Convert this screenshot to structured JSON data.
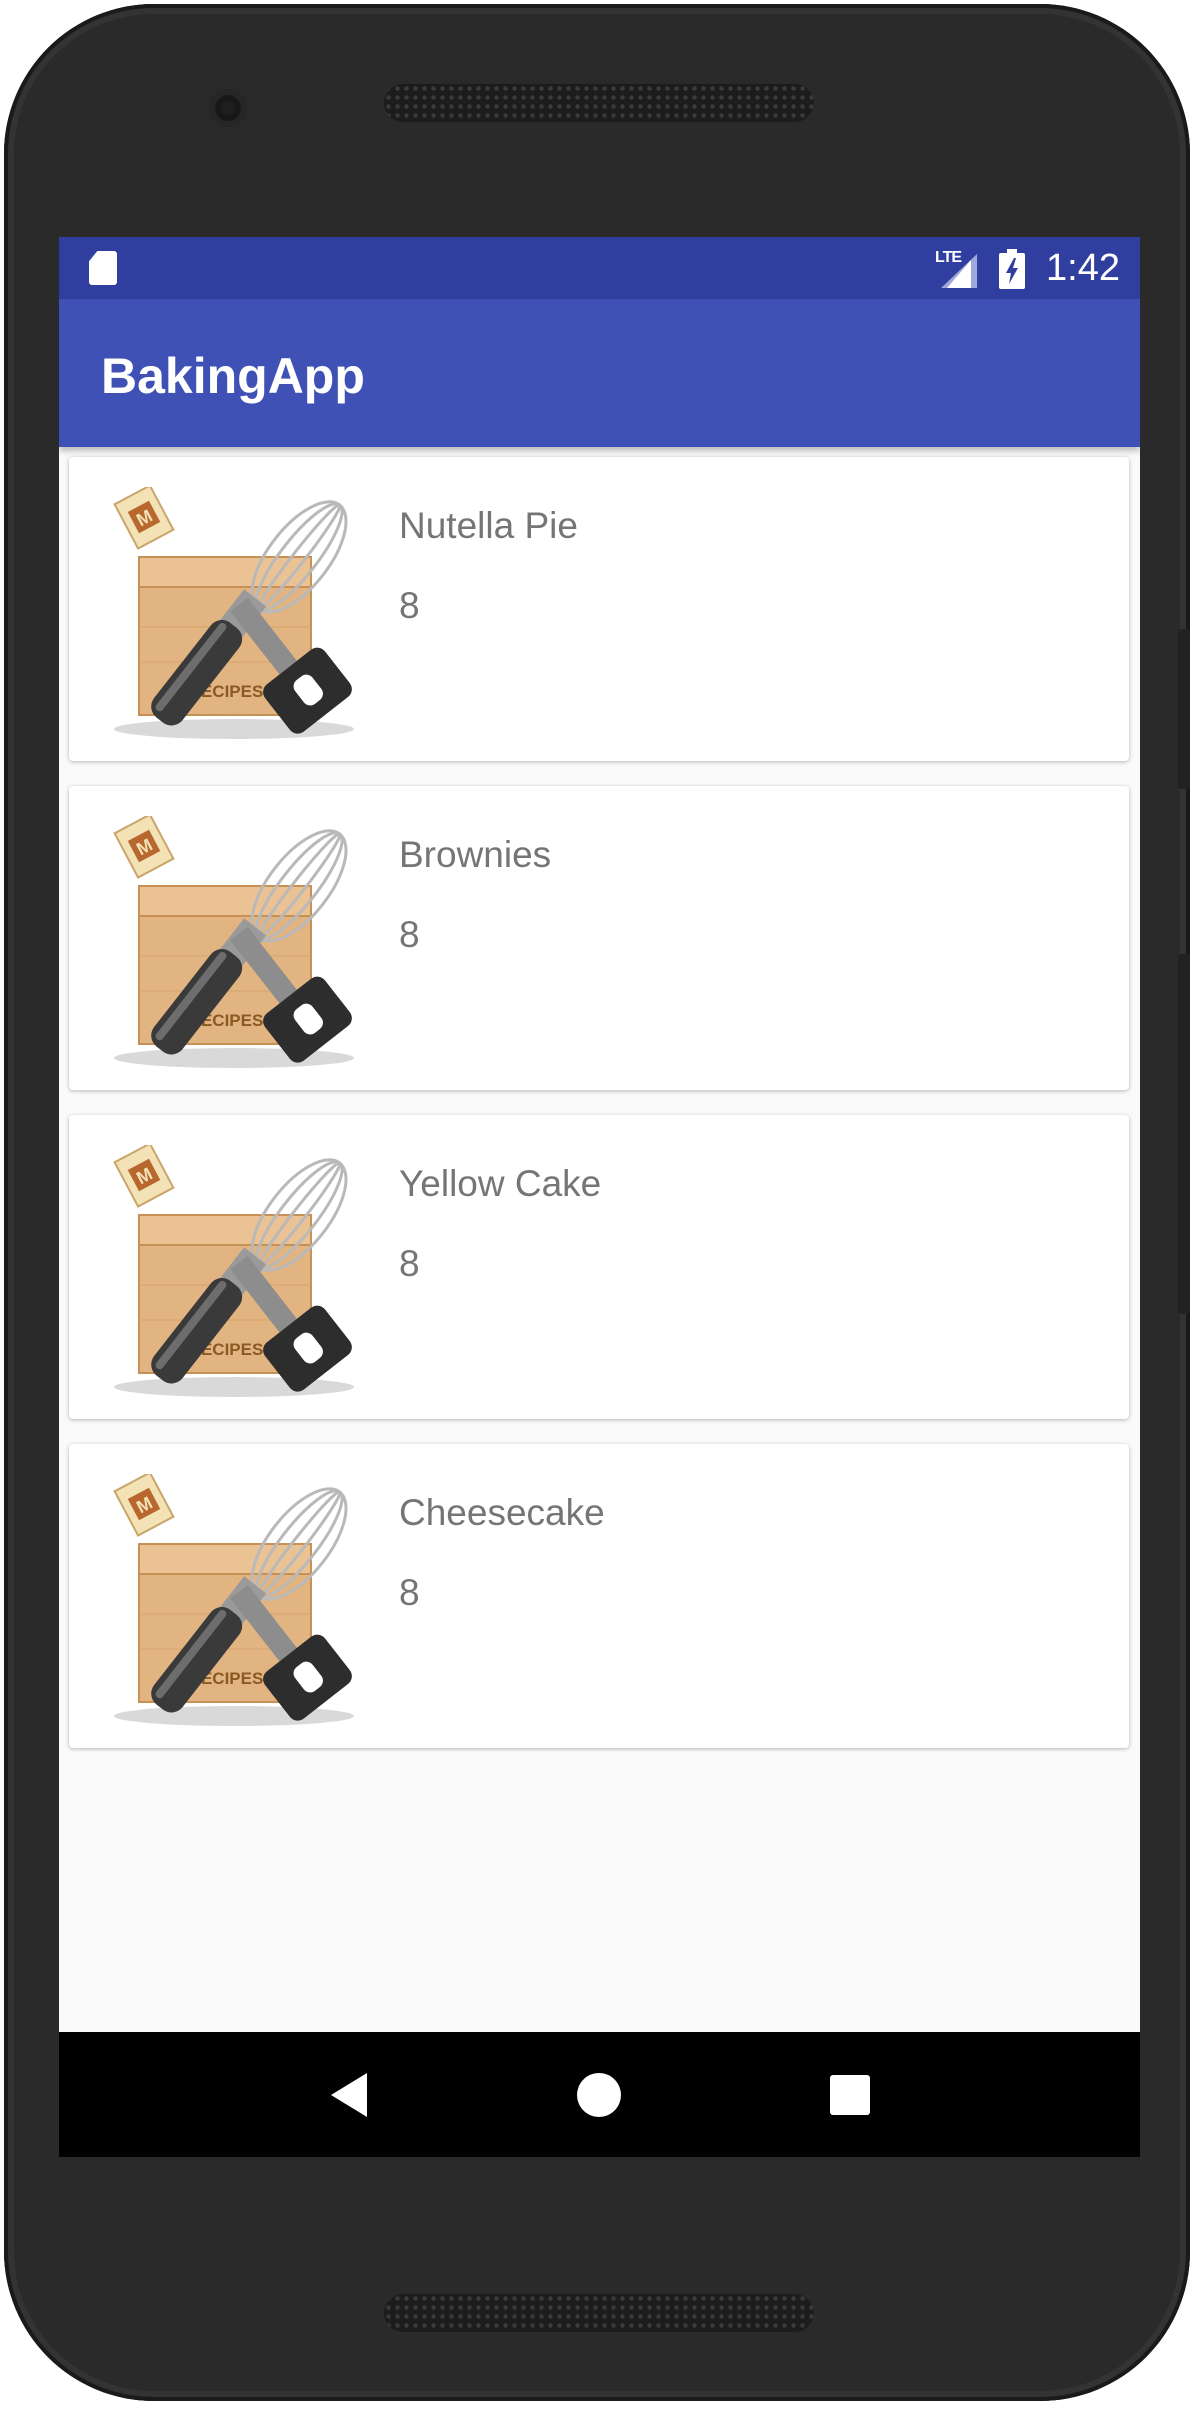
{
  "status_bar": {
    "network": "LTE",
    "time": "1:42",
    "icons": [
      "sd-card-icon",
      "signal-icon",
      "battery-charging-icon"
    ]
  },
  "app_bar": {
    "title": "BakingApp"
  },
  "recipes": [
    {
      "name": "Nutella Pie",
      "servings": "8",
      "image_label": "RECIPES"
    },
    {
      "name": "Brownies",
      "servings": "8",
      "image_label": "RECIPES"
    },
    {
      "name": "Yellow Cake",
      "servings": "8",
      "image_label": "RECIPES"
    },
    {
      "name": "Cheesecake",
      "servings": "8",
      "image_label": "RECIPES"
    }
  ],
  "nav_bar": {
    "icons": [
      "back-icon",
      "home-icon",
      "recents-icon"
    ]
  },
  "colors": {
    "primary": "#3f51b5",
    "primary_dark": "#303f9f",
    "card_text": "#757575",
    "background": "#fafafa"
  }
}
